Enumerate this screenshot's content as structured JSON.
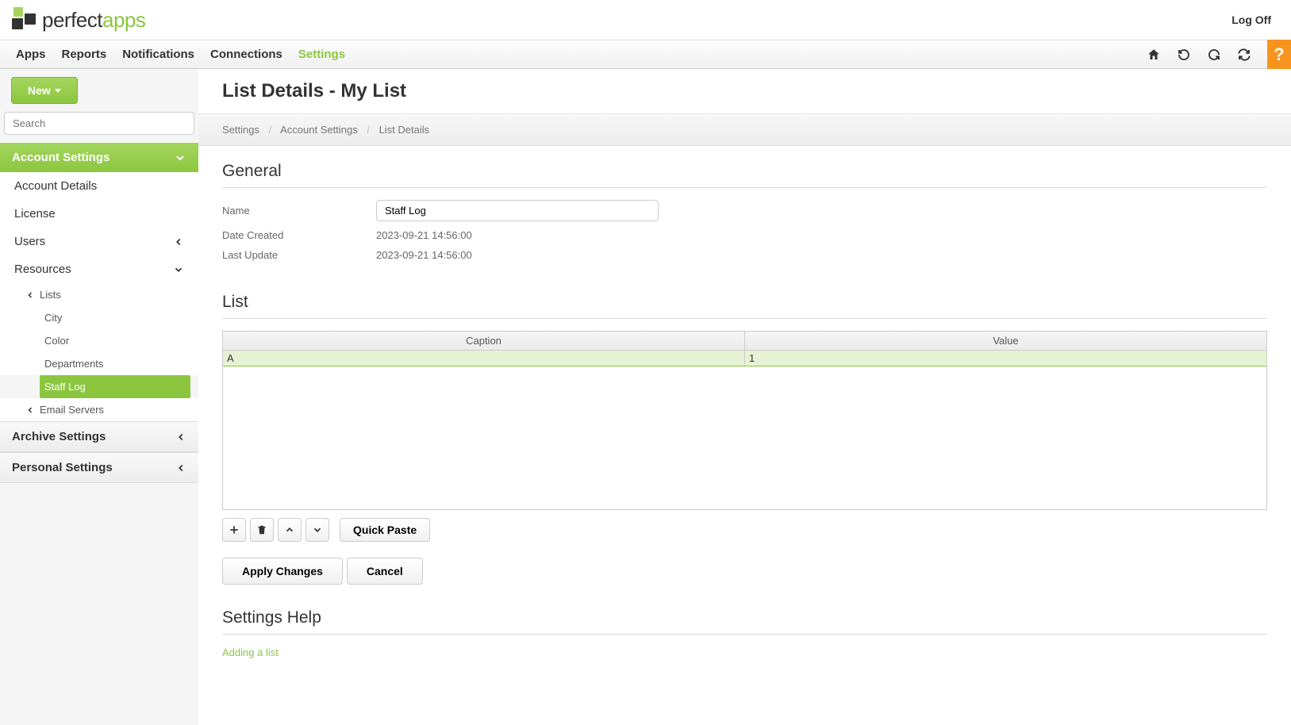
{
  "header": {
    "logo_text_1": "perfect",
    "logo_text_2": "apps",
    "logoff_label": "Log Off"
  },
  "topnav": {
    "items": [
      "Apps",
      "Reports",
      "Notifications",
      "Connections",
      "Settings"
    ],
    "active_index": 4
  },
  "sidebar": {
    "new_button_label": "New",
    "search_placeholder": "Search",
    "sections": {
      "account_settings": {
        "label": "Account Settings",
        "items": [
          "Account Details",
          "License",
          "Users",
          "Resources"
        ],
        "resources_children": [
          "Lists",
          "Email Servers"
        ],
        "lists_children": [
          "City",
          "Color",
          "Departments",
          "Staff Log"
        ],
        "lists_active": "Staff Log"
      },
      "archive_settings": {
        "label": "Archive Settings"
      },
      "personal_settings": {
        "label": "Personal Settings"
      }
    }
  },
  "page": {
    "title": "List Details - My List",
    "breadcrumb": [
      "Settings",
      "Account Settings",
      "List Details"
    ]
  },
  "general": {
    "heading": "General",
    "name_label": "Name",
    "name_value": "Staff Log",
    "date_created_label": "Date Created",
    "date_created_value": "2023-09-21 14:56:00",
    "last_update_label": "Last Update",
    "last_update_value": "2023-09-21 14:56:00"
  },
  "list": {
    "heading": "List",
    "columns": [
      "Caption",
      "Value"
    ],
    "rows": [
      [
        "A",
        "1"
      ]
    ],
    "quick_paste_label": "Quick Paste"
  },
  "actions": {
    "apply_label": "Apply Changes",
    "cancel_label": "Cancel"
  },
  "help": {
    "heading": "Settings Help",
    "link_text": "Adding a list"
  }
}
